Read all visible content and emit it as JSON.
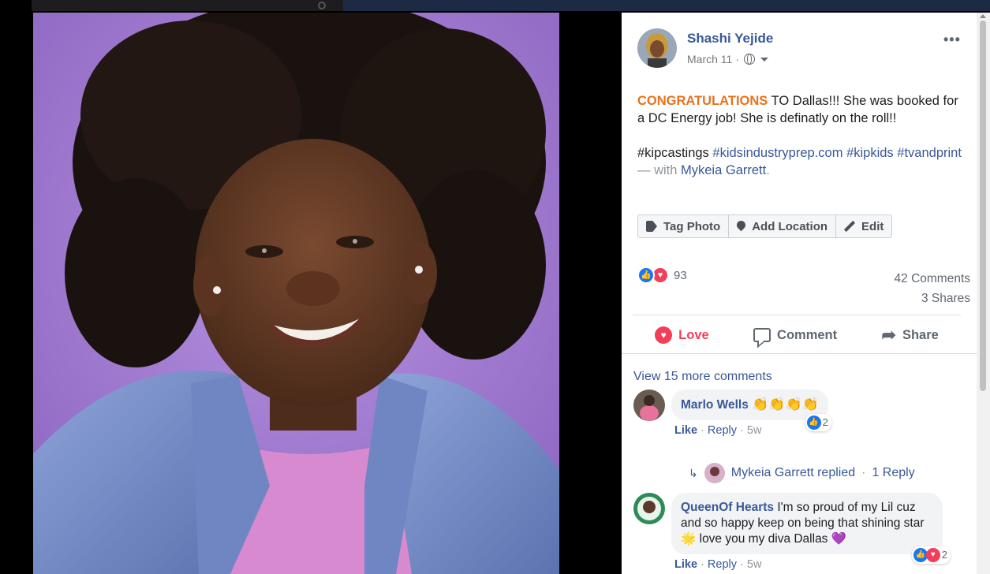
{
  "post": {
    "author": "Shashi Yejide",
    "date": "March 11",
    "date_sep": "·",
    "more_icon": "more-dots-icon",
    "text": {
      "congrats": "CONGRATULATIONS",
      "line1_rest": " TO Dallas!!! She was booked for a DC Energy job! She is definatly on the roll!!",
      "hashtag_plain1": "#kipcastings ",
      "hashtag_link1": "#kidsindustryprep.com",
      "hashtag_space": " ",
      "hashtag_link2": "#kipkids",
      "hashtag_link3": "#tvandprint",
      "with_text": " — with ",
      "with_name": "Mykeia Garrett",
      "with_end": "."
    },
    "photo_actions": [
      {
        "label": "Tag Photo",
        "icon": "tag-icon"
      },
      {
        "label": "Add Location",
        "icon": "location-pin-icon"
      },
      {
        "label": "Edit",
        "icon": "pencil-icon"
      }
    ],
    "reaction_count": "93",
    "comments_count": "42 Comments",
    "shares_count": "3 Shares",
    "like_bar": {
      "love": "Love",
      "comment": "Comment",
      "share": "Share"
    }
  },
  "comments_section": {
    "view_more": "View 15 more comments",
    "comments": [
      {
        "name": "Marlo Wells",
        "text": "",
        "emoji": "👏👏👏👏",
        "like": "Like",
        "reply": "Reply",
        "time": "5w",
        "reactions": "2"
      },
      {
        "name": "QueenOf Hearts",
        "text": " I'm so proud of my Lil cuz and so happy keep on being that shining star ",
        "star": "🌟",
        "text2": " love you my diva Dallas ",
        "heart": "💜",
        "like": "Like",
        "reply": "Reply",
        "time": "5w",
        "reactions": "2"
      }
    ],
    "reply_summary": {
      "name": "Mykeia Garrett replied",
      "sep": "·",
      "count": "1 Reply"
    }
  },
  "colors": {
    "link": "#385898",
    "congrats": "#e9711c",
    "love": "#f33e58",
    "like": "#1877f2",
    "photo_bg": "#a57fd0"
  }
}
